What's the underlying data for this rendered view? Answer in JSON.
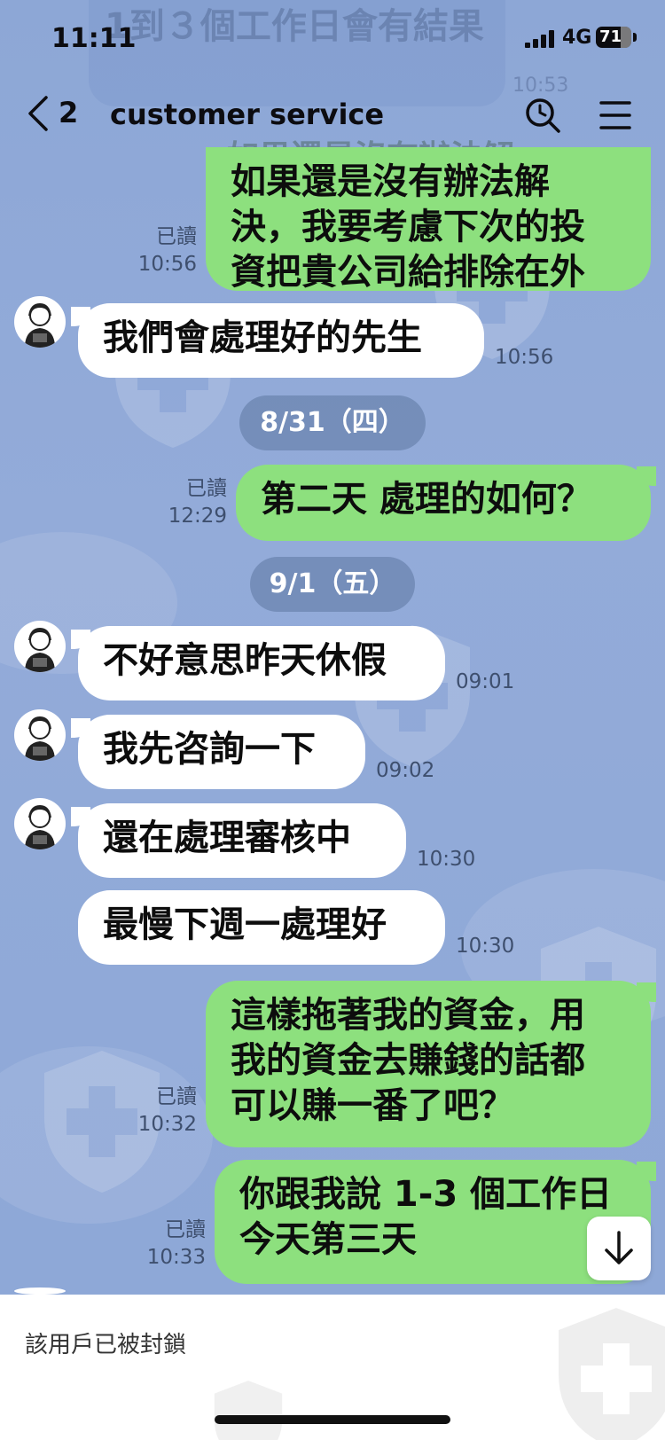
{
  "status_bar": {
    "time": "11:11",
    "network": "4G",
    "battery": "71",
    "battery_level": 0.71
  },
  "header": {
    "back_count": "2",
    "title": "customer service"
  },
  "ghost": {
    "text": "1到３個工作日會有結果",
    "time": "10:53",
    "next_text": "如果還是沒有辦法解"
  },
  "messages": [
    {
      "side": "out",
      "text": "如果還是沒有辦法解\n決，我要考慮下次的投\n資把貴公司給排除在外",
      "read": "已讀",
      "time": "10:56"
    },
    {
      "side": "in",
      "text": "我們會處理好的先生",
      "time": "10:56"
    },
    {
      "side": "out",
      "text": "第二天 處理的如何？",
      "read": "已讀",
      "time": "12:29"
    },
    {
      "side": "in",
      "text": "不好意思昨天休假",
      "time": "09:01"
    },
    {
      "side": "in",
      "text": "我先咨詢一下",
      "time": "09:02"
    },
    {
      "side": "in",
      "text": "還在處理審核中",
      "time": "10:30"
    },
    {
      "side": "in",
      "text": "最慢下週一處理好",
      "time": "10:30"
    },
    {
      "side": "out",
      "text": "這樣拖著我的資金，用\n我的資金去賺錢的話都\n可以賺一番了吧？",
      "read": "已讀",
      "time": "10:32"
    },
    {
      "side": "out",
      "text": "你跟我說 1-3 個工作日\n今天第三天",
      "read": "已讀",
      "time": "10:33"
    }
  ],
  "dates": [
    "8/31（四）",
    "9/1（五）"
  ],
  "footer": {
    "blocked_text": "該用戶已被封鎖"
  },
  "colors": {
    "background": "#8fa9d8",
    "outgoing_bubble": "#8de07e",
    "incoming_bubble": "#ffffff",
    "date_pill": "#5c76a0"
  },
  "icons": [
    "back-chevron-icon",
    "search-icon",
    "menu-icon",
    "scroll-down-arrow-icon",
    "agent-avatar-icon"
  ]
}
